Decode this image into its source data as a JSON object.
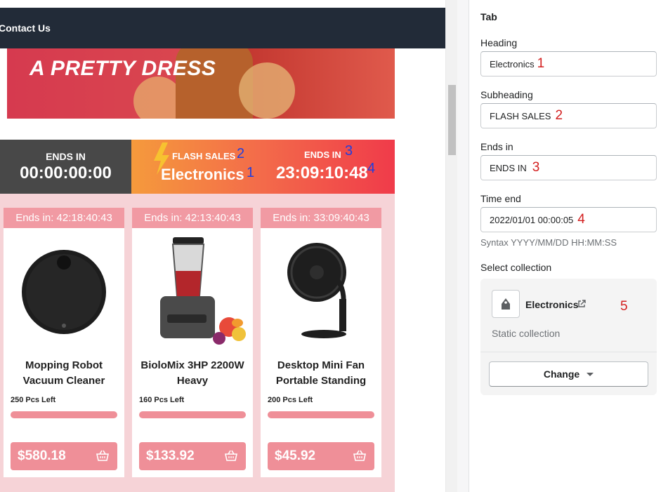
{
  "navbar": {
    "link": "Contact Us"
  },
  "banner": {
    "title": "A PRETTY DRESS"
  },
  "timer": {
    "left_label": "ENDS IN",
    "left_time": "00:00:00:00",
    "subheading": "FLASH SALES",
    "heading": "Electronics",
    "right_label": "ENDS IN",
    "right_time": "23:09:10:48"
  },
  "preview_annotations": {
    "a1": "1",
    "a2": "2",
    "a3": "3",
    "a4": "4",
    "a5": "5"
  },
  "products": [
    {
      "ends": "Ends in: 42:18:40:43",
      "title_line1": "Mopping Robot",
      "title_line2": "Vacuum Cleaner",
      "stock": "250 Pcs Left",
      "price": "$580.18",
      "image": "robot-vacuum-image"
    },
    {
      "ends": "Ends in: 42:13:40:43",
      "title_line1": "BioloMix 3HP 2200W",
      "title_line2": "Heavy",
      "stock": "160 Pcs Left",
      "price": "$133.92",
      "image": "blender-image"
    },
    {
      "ends": "Ends in: 33:09:40:43",
      "title_line1": "Desktop Mini Fan",
      "title_line2": "Portable Standing",
      "stock": "200 Pcs Left",
      "price": "$45.92",
      "image": "fan-image"
    }
  ],
  "panel": {
    "title": "Tab",
    "heading_label": "Heading",
    "heading_value": "Electronics",
    "subheading_label": "Subheading",
    "subheading_value": "FLASH SALES",
    "ends_label": "Ends in",
    "ends_value": "ENDS IN",
    "time_label": "Time end",
    "time_value": "2022/01/01 00:00:05",
    "time_help": "Syntax YYYY/MM/DD HH:MM:SS",
    "collection_label": "Select collection",
    "collection_name": "Electronics",
    "collection_type": "Static collection",
    "change_label": "Change",
    "annotations": {
      "a1": "1",
      "a2": "2",
      "a3": "3",
      "a4": "4",
      "a5": "5"
    }
  },
  "colors": {
    "navbar": "#222b38",
    "timer_left": "#484848",
    "accent_orange": "#f59a3c",
    "accent_red": "#f03b4a",
    "product_bg": "#f6d3d7",
    "product_accent": "#ef8f98",
    "annotation_blue": "#1f3fe0",
    "annotation_red": "#d31f1f"
  }
}
